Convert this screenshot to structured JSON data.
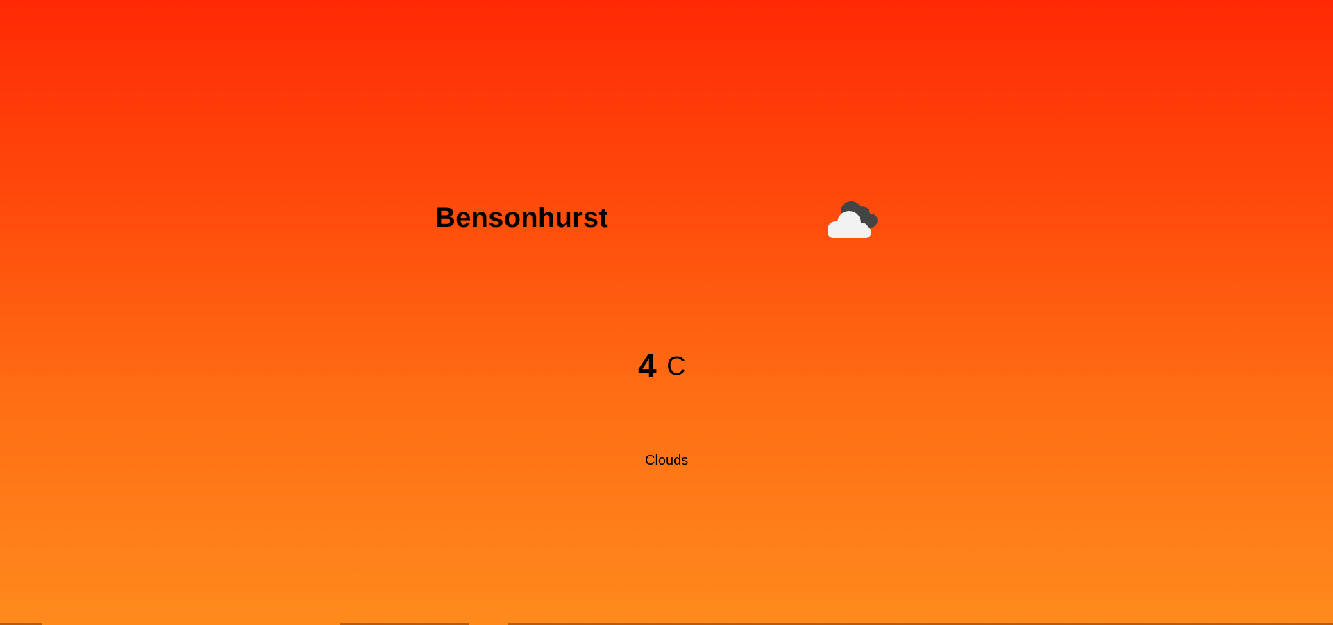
{
  "location": {
    "city": "Bensonhurst"
  },
  "weather": {
    "icon": "cloud-icon",
    "temperature_value": "4",
    "temperature_unit": "C",
    "condition": "Clouds"
  },
  "colors": {
    "background_top": "#ff2a04",
    "background_bottom": "#ff8a1c",
    "text": "#000000",
    "cloud_front": "#f2f2f2",
    "cloud_back": "#444444"
  }
}
